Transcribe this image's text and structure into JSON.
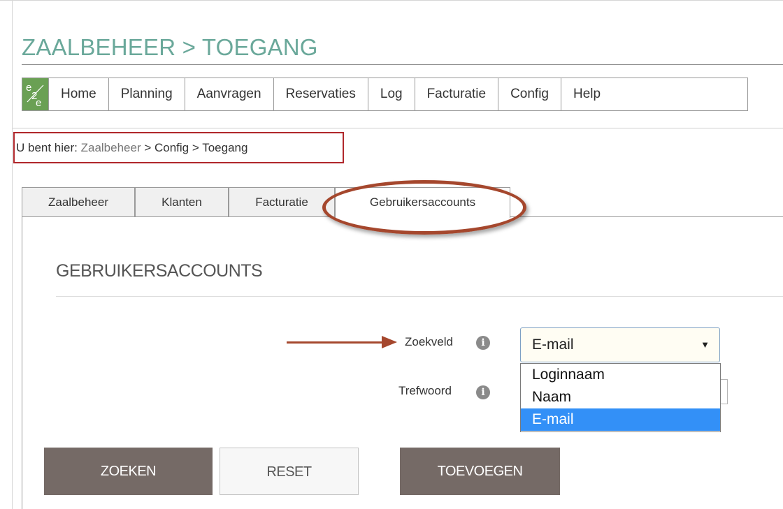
{
  "page": {
    "title": "ZAALBEHEER > TOEGANG"
  },
  "nav": {
    "logo_text": "e2e",
    "items": [
      {
        "label": "Home"
      },
      {
        "label": "Planning"
      },
      {
        "label": "Aanvragen"
      },
      {
        "label": "Reservaties"
      },
      {
        "label": "Log"
      },
      {
        "label": "Facturatie"
      },
      {
        "label": "Config"
      },
      {
        "label": "Help"
      }
    ]
  },
  "breadcrumb": {
    "prefix": "U bent hier: ",
    "links": [
      "Zaalbeheer",
      "Config",
      "Toegang"
    ],
    "separator": " > "
  },
  "tabs": [
    {
      "label": "Zaalbeheer"
    },
    {
      "label": "Klanten"
    },
    {
      "label": "Facturatie"
    },
    {
      "label": "Gebruikersaccounts",
      "active": true
    }
  ],
  "section": {
    "heading": "GEBRUIKERSACCOUNTS"
  },
  "form": {
    "zoekveld_label": "Zoekveld",
    "zoekveld_value": "E-mail",
    "trefwoord_label": "Trefwoord",
    "trefwoord_value": "",
    "dropdown_options": [
      "Loginnaam",
      "Naam",
      "E-mail"
    ],
    "selected_option": "E-mail"
  },
  "buttons": {
    "search": "ZOEKEN",
    "reset": "RESET",
    "add": "TOEVOEGEN"
  },
  "colors": {
    "title_teal": "#6aa89a",
    "annotation_red": "#a5472d",
    "highlight_blue": "#3390f7",
    "button_dark": "#756a66"
  },
  "icons": {
    "info": "info-icon",
    "select_arrow": "chevron-down-icon",
    "annotation_arrow": "arrow-right-icon"
  }
}
